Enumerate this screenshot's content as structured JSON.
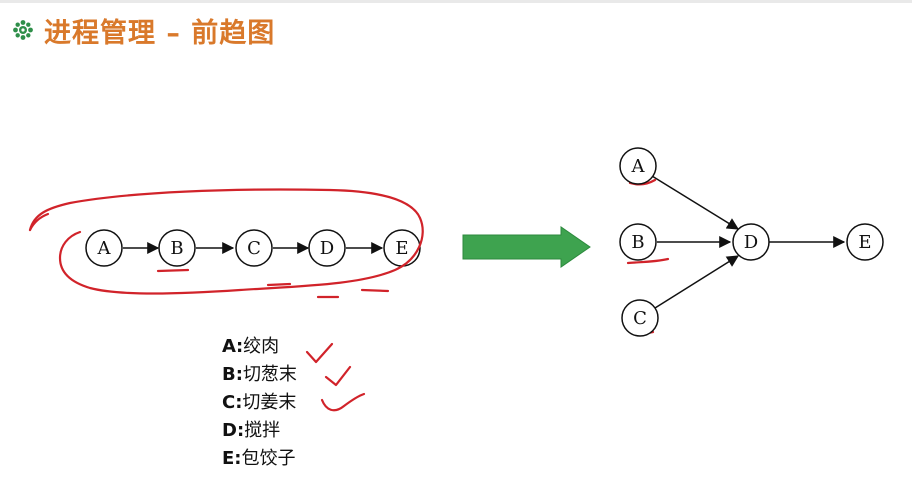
{
  "header": {
    "title": "进程管理 – 前趋图",
    "bullet_icon": "gear-flower-icon",
    "title_color": "#d9792b"
  },
  "left_graph": {
    "type": "chain",
    "nodes": [
      "A",
      "B",
      "C",
      "D",
      "E"
    ],
    "edges": [
      [
        "A",
        "B"
      ],
      [
        "B",
        "C"
      ],
      [
        "C",
        "D"
      ],
      [
        "D",
        "E"
      ]
    ]
  },
  "transform_arrow": {
    "icon": "right-arrow-icon",
    "color": "#3ea34f"
  },
  "right_graph": {
    "type": "dag",
    "nodes": [
      "A",
      "B",
      "C",
      "D",
      "E"
    ],
    "edges": [
      [
        "A",
        "D"
      ],
      [
        "B",
        "D"
      ],
      [
        "C",
        "D"
      ],
      [
        "D",
        "E"
      ]
    ]
  },
  "legend": [
    {
      "key": "A",
      "sep": ":",
      "text": "绞肉"
    },
    {
      "key": "B",
      "sep": ":",
      "text": "切葱末"
    },
    {
      "key": "C",
      "sep": ":",
      "text": "切姜末"
    },
    {
      "key": "D",
      "sep": ":",
      "text": "搅拌"
    },
    {
      "key": "E",
      "sep": ":",
      "text": "包饺子"
    }
  ],
  "annotation_color": "#d1232a"
}
